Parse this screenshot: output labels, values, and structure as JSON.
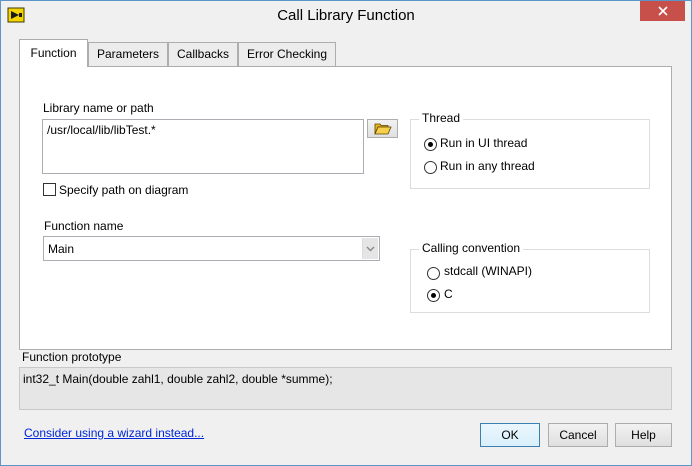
{
  "window": {
    "title": "Call Library Function"
  },
  "tabs": [
    {
      "label": "Function"
    },
    {
      "label": "Parameters"
    },
    {
      "label": "Callbacks"
    },
    {
      "label": "Error Checking"
    }
  ],
  "function_tab": {
    "library_label": "Library name or path",
    "library_value": "/usr/local/lib/libTest.*",
    "specify_path_label": "Specify path on diagram",
    "function_name_label": "Function name",
    "function_name_value": "Main",
    "thread": {
      "title": "Thread",
      "options": [
        {
          "label": "Run in UI thread",
          "selected": true
        },
        {
          "label": "Run in any thread",
          "selected": false
        }
      ]
    },
    "calling_convention": {
      "title": "Calling convention",
      "options": [
        {
          "label": "stdcall (WINAPI)",
          "selected": false
        },
        {
          "label": "C",
          "selected": true
        }
      ]
    }
  },
  "prototype": {
    "label": "Function prototype",
    "value": "int32_t Main(double zahl1, double zahl2, double *summe);"
  },
  "footer": {
    "wizard_link": "Consider using a wizard instead...",
    "ok_label": "OK",
    "cancel_label": "Cancel",
    "help_label": "Help"
  },
  "colors": {
    "close_button": "#c7504b",
    "link": "#0026d9",
    "border_accent": "#5c95c9"
  }
}
